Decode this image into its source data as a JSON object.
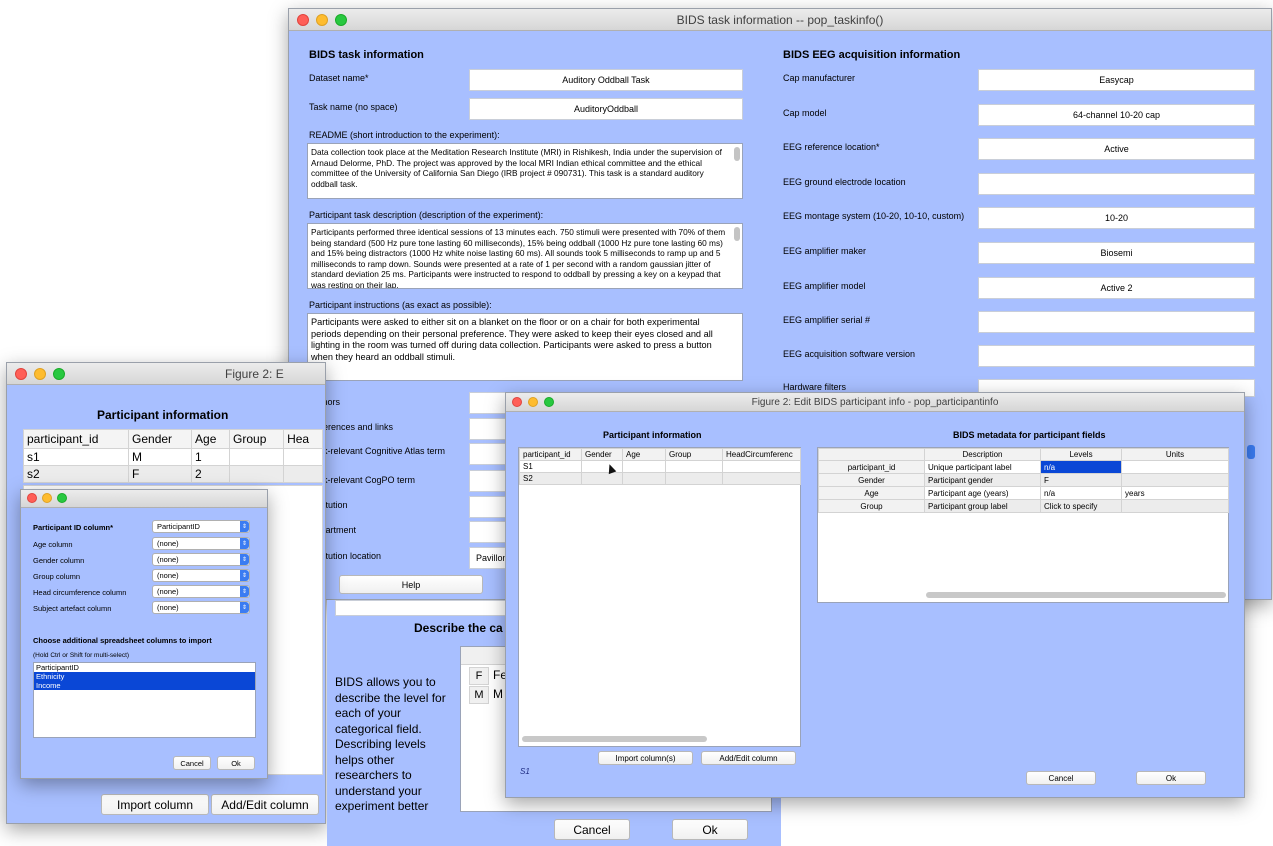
{
  "taskinfo": {
    "title": "BIDS task information -- pop_taskinfo()",
    "left_header": "BIDS task information",
    "right_header": "BIDS EEG acquisition information",
    "dataset_label": "Dataset name*",
    "dataset_value": "Auditory Oddball Task",
    "taskname_label": "Task name (no space)",
    "taskname_value": "AuditoryOddball",
    "readme_label": "README (short introduction to the experiment):",
    "readme_text": "Data collection took place at the Meditation Research Institute (MRI) in Rishikesh, India under the supervision of Arnaud Delorme, PhD. The project was approved by the local MRI Indian ethical committee and the ethical committee of the University of California San Diego (IRB project # 090731). This task is a standard auditory oddball task.",
    "desc_label": "Participant task description (description of the experiment):",
    "desc_text": "Participants performed three identical sessions of 13 minutes each. 750 stimuli were presented with 70% of them being standard (500 Hz pure tone lasting 60 milliseconds), 15% being oddball (1000 Hz pure tone lasting 60 ms) and 15% being distractors (1000 Hz white noise lasting 60 ms). All sounds took 5 milliseconds to ramp up and 5 milliseconds to ramp down. Sounds were presented at a rate of 1 per second with a random gaussian jitter of standard deviation 25 ms. Participants were instructed to respond to oddball by pressing a key on a keypad that was resting on their lap.",
    "instr_label": "Participant instructions (as exact as possible):",
    "instr_text": "Participants were asked to either sit on a blanket on the floor or on a chair for both experimental periods depending on their personal preference. They were asked to keep their eyes closed and all lighting in the room was turned off during data collection. Participants were asked to press a button when they heard an oddball stimuli.",
    "authors_label": "Authors",
    "refs_label": "References and links",
    "cogatlas_label": "Task-relevant Cognitive Atlas term",
    "cogpo_label": "Task-relevant CogPO term",
    "institution_label": "Institution",
    "department_label": "Department",
    "location_label": "Institution location",
    "location_value": "Pavillon",
    "help_label": "Help",
    "cap_manufacturer_label": "Cap manufacturer",
    "cap_manufacturer_value": "Easycap",
    "cap_model_label": "Cap model",
    "cap_model_value": "64-channel 10-20 cap",
    "ref_label": "EEG reference location*",
    "ref_value": "Active",
    "ground_label": "EEG ground electrode location",
    "montage_label": "EEG montage system (10-20, 10-10, custom)",
    "montage_value": "10-20",
    "amp_maker_label": "EEG amplifier maker",
    "amp_maker_value": "Biosemi",
    "amp_model_label": "EEG amplifier model",
    "amp_model_value": "Active 2",
    "amp_serial_label": "EEG amplifier serial #",
    "software_label": "EEG acquisition software version",
    "filters_label": "Hardware filters"
  },
  "fig2_left": {
    "title": "Figure 2: E",
    "header": "Participant information",
    "columns": [
      "participant_id",
      "Gender",
      "Age",
      "Group",
      "Hea"
    ],
    "rows": [
      [
        "s1",
        "M",
        "1",
        "",
        ""
      ],
      [
        "s2",
        "F",
        "2",
        "",
        ""
      ]
    ],
    "import_label": "Import column",
    "addedit_label": "Add/Edit column"
  },
  "import_dialog": {
    "pid_label": "Participant ID column*",
    "pid_value": "ParticipantID",
    "age_label": "Age column",
    "gender_label": "Gender column",
    "group_label": "Group column",
    "head_label": "Head circumference column",
    "artefact_label": "Subject artefact column",
    "none_value": "(none)",
    "choose_label": "Choose additional spreadsheet columns to import",
    "hint_label": "(Hold Ctrl or Shift for multi-select)",
    "list": [
      "ParticipantID",
      "Ethnicity",
      "Income"
    ],
    "cancel_label": "Cancel",
    "ok_label": "Ok"
  },
  "describe_panel": {
    "header": "Describe the ca",
    "text": "BIDS allows you to describe the level for each of your categorical field. Describing levels helps other researchers to understand your experiment better",
    "rows": [
      [
        "F",
        "Fe"
      ],
      [
        "M",
        "M"
      ]
    ],
    "cancel_label": "Cancel",
    "ok_label": "Ok"
  },
  "participant_info": {
    "title": "Figure 2: Edit BIDS participant info - pop_participantinfo",
    "left_header": "Participant information",
    "right_header": "BIDS metadata for participant fields",
    "columns": [
      "participant_id",
      "Gender",
      "Age",
      "Group",
      "HeadCircumferenc"
    ],
    "rows": [
      [
        "S1",
        "",
        "",
        "",
        ""
      ],
      [
        "S2",
        "",
        "",
        "",
        ""
      ]
    ],
    "meta_columns": [
      "",
      "Description",
      "Levels",
      "Units"
    ],
    "meta_rows": [
      [
        "participant_id",
        "Unique participant label",
        "n/a",
        ""
      ],
      [
        "Gender",
        "Participant gender",
        "F",
        ""
      ],
      [
        "Age",
        "Participant age (years)",
        "n/a",
        "years"
      ],
      [
        "Group",
        "Participant group label",
        "Click to specify",
        ""
      ]
    ],
    "import_label": "Import column(s)",
    "addedit_label": "Add/Edit column",
    "status": "S1",
    "cancel_label": "Cancel",
    "ok_label": "Ok"
  }
}
